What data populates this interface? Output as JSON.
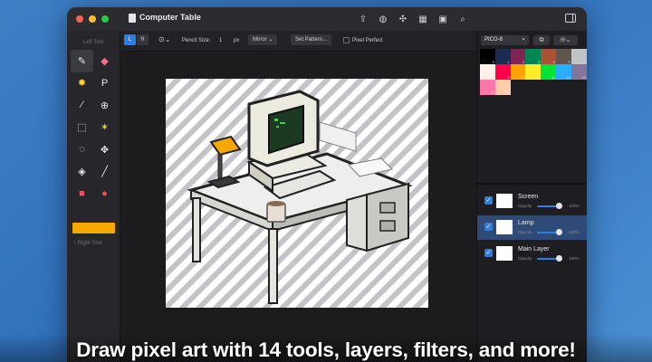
{
  "window": {
    "title": "Computer Table"
  },
  "toolbar_icons": [
    "share-icon",
    "palette-icon",
    "effects-icon",
    "grid-icon",
    "image-icon",
    "search-icon"
  ],
  "left_panel": {
    "header": "Left Tool",
    "tools": [
      {
        "name": "pencil-tool",
        "glyph": "✎"
      },
      {
        "name": "eraser-tool",
        "glyph": "◆"
      },
      {
        "name": "brightness-tool",
        "glyph": "✹"
      },
      {
        "name": "pattern-tool",
        "glyph": "P"
      },
      {
        "name": "eyedropper-tool",
        "glyph": "⁄"
      },
      {
        "name": "zoom-tool",
        "glyph": "⊕"
      },
      {
        "name": "rect-select-tool",
        "glyph": "⬚"
      },
      {
        "name": "magic-wand-tool",
        "glyph": "✶"
      },
      {
        "name": "lasso-tool",
        "glyph": "◌"
      },
      {
        "name": "move-tool",
        "glyph": "✥"
      },
      {
        "name": "bucket-tool",
        "glyph": "◈"
      },
      {
        "name": "line-tool",
        "glyph": "╱"
      },
      {
        "name": "rectangle-tool",
        "glyph": "■"
      },
      {
        "name": "ellipse-tool",
        "glyph": "●"
      }
    ],
    "selected_color": "#f5a800",
    "right_tool_label": "Right Tool"
  },
  "options": {
    "left_btn": "L",
    "right_btn": "R",
    "pencil_size_label": "Pencil Size:",
    "pencil_size_value": "1",
    "unit": "px",
    "mirror": "Mirror",
    "set_pattern": "Set Pattern...",
    "pixel_perfect": "Pixel Perfect"
  },
  "palette": {
    "name": "PICO-8",
    "colors": [
      "#000000",
      "#1d2b53",
      "#7e2553",
      "#008751",
      "#ab5236",
      "#5f574f",
      "#c2c3c7",
      "#fff1e8",
      "#ff004d",
      "#ffa300",
      "#ffec27",
      "#00e436",
      "#29adff",
      "#83769c",
      "#ff77a8",
      "#ffccaa"
    ],
    "labels": [
      "0",
      "1",
      "2",
      "3",
      "4",
      "5",
      "6",
      "7",
      "8",
      "9",
      "10",
      "11",
      "12",
      "13",
      "14",
      "15"
    ]
  },
  "layers": [
    {
      "name": "Screen",
      "opacity_label": "Opacity",
      "opacity": "100%",
      "selected": false
    },
    {
      "name": "Lamp",
      "opacity_label": "Opacity",
      "opacity": "100%",
      "selected": true
    },
    {
      "name": "Main Layer",
      "opacity_label": "Opacity",
      "opacity": "100%",
      "selected": false
    }
  ],
  "caption": "Draw pixel art with 14 tools, layers, filters, and more!"
}
